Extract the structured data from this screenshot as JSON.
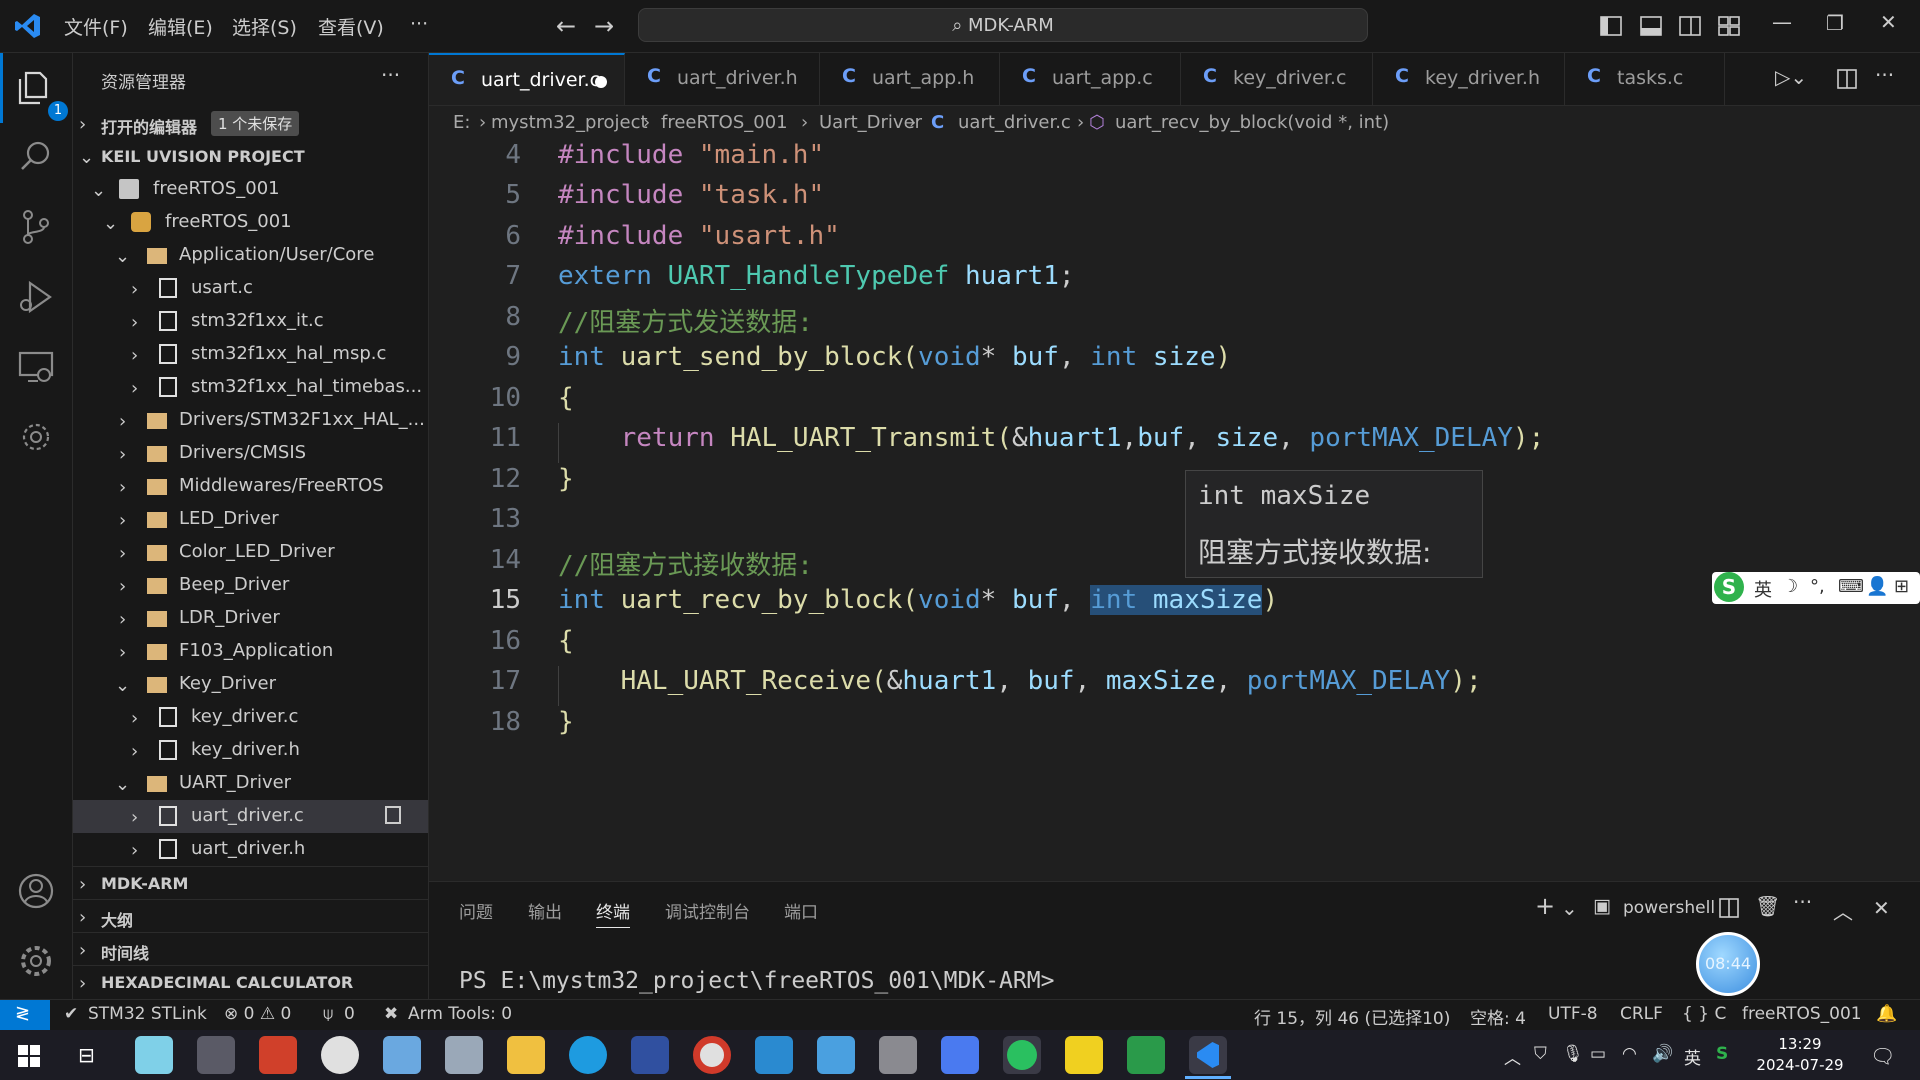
{
  "titlebar": {
    "menus": [
      "文件(F)",
      "编辑(E)",
      "选择(S)",
      "查看(V)",
      "···"
    ],
    "search_text": "MDK-ARM"
  },
  "activity": {
    "explorer_badge": "1"
  },
  "sidebar": {
    "title": "资源管理器",
    "more": "···",
    "open_editors": "打开的编辑器",
    "unsaved_badge": "1 个未保存",
    "project": "KEIL UVISION PROJECT",
    "tree": [
      {
        "label": "freeRTOS_001"
      },
      {
        "label": "freeRTOS_001"
      },
      {
        "label": "Application/User/Core"
      },
      {
        "label": "usart.c"
      },
      {
        "label": "stm32f1xx_it.c"
      },
      {
        "label": "stm32f1xx_hal_msp.c"
      },
      {
        "label": "stm32f1xx_hal_timebas..."
      },
      {
        "label": "Drivers/STM32F1xx_HAL_..."
      },
      {
        "label": "Drivers/CMSIS"
      },
      {
        "label": "Middlewares/FreeRTOS"
      },
      {
        "label": "LED_Driver"
      },
      {
        "label": "Color_LED_Driver"
      },
      {
        "label": "Beep_Driver"
      },
      {
        "label": "LDR_Driver"
      },
      {
        "label": "F103_Application"
      },
      {
        "label": "Key_Driver"
      },
      {
        "label": "key_driver.c"
      },
      {
        "label": "key_driver.h"
      },
      {
        "label": "UART_Driver"
      },
      {
        "label": "uart_driver.c"
      },
      {
        "label": "uart_driver.h"
      }
    ],
    "sections": [
      "MDK-ARM",
      "大纲",
      "时间线",
      "HEXADECIMAL CALCULATOR"
    ]
  },
  "tabs": [
    {
      "label": "uart_driver.c"
    },
    {
      "label": "uart_driver.h"
    },
    {
      "label": "uart_app.h"
    },
    {
      "label": "uart_app.c"
    },
    {
      "label": "key_driver.c"
    },
    {
      "label": "key_driver.h"
    },
    {
      "label": "tasks.c"
    }
  ],
  "tab_icon_letter": "C",
  "breadcrumb": [
    "E:",
    "mystm32_project",
    "freeRTOS_001",
    "Uart_Driver",
    "uart_driver.c",
    "uart_recv_by_block(void *, int)"
  ],
  "editor": {
    "line_numbers": [
      "4",
      "5",
      "6",
      "7",
      "8",
      "9",
      "10",
      "11",
      "12",
      "13",
      "14",
      "15",
      "16",
      "17",
      "18"
    ],
    "t": {
      "inc": "#include",
      "main_h": "\"main.h\"",
      "task_h": "\"task.h\"",
      "usart_h": "\"usart.h\"",
      "extern": "extern",
      "uart_type": "UART_HandleTypeDef",
      "huart1": "huart1",
      "semi": ";",
      "cmt_send": "//阻塞方式发送数据:",
      "int": "int",
      "send_fn": "uart_send_by_block",
      "lparen": "(",
      "void": "void",
      "star": "*",
      "buf": "buf",
      "comma": ",",
      "size": "size",
      "rparen": ")",
      "lbrace": "{",
      "rbrace": "}",
      "return": "return",
      "transmit": "HAL_UART_Transmit",
      "amp": "&",
      "max_delay": "portMAX_DELAY",
      "close_semi": ");",
      "cmt_recv": "//阻塞方式接收数据:",
      "recv_fn": "uart_recv_by_block",
      "maxsize": "maxSize",
      "receive": "HAL_UART_Receive"
    },
    "hover_signature": "int maxSize",
    "hover_doc": "阻塞方式接收数据:"
  },
  "ime": [
    "英",
    "☽",
    "°,",
    "⌨",
    "👤",
    "⊞"
  ],
  "panel": {
    "tabs": [
      "问题",
      "输出",
      "终端",
      "调试控制台",
      "端口"
    ],
    "shell": "powershell",
    "prompt": "PS E:\\mystm32_project\\freeRTOS_001\\MDK-ARM>",
    "timer": "08:44"
  },
  "statusbar": {
    "stlink": "STM32 STLink",
    "problems": "⊗ 0 ⚠ 0",
    "ports": "0",
    "arm_tools": "Arm Tools: 0",
    "position": "行 15，列 46 (已选择10)",
    "spaces": "空格: 4",
    "encoding": "UTF-8",
    "eol": "CRLF",
    "language": "{ } C",
    "project": "freeRTOS_001"
  },
  "taskbar": {
    "time": "13:29",
    "date": "2024-07-29",
    "ime_lang": "英"
  },
  "colors": {
    "accent": "#0078d4",
    "keyword": "#569cd6",
    "string": "#ce9178",
    "type": "#4ec9b0",
    "function": "#dcdcaa",
    "variable": "#9cdcfe",
    "comment": "#6a9955",
    "control": "#c586c0"
  }
}
